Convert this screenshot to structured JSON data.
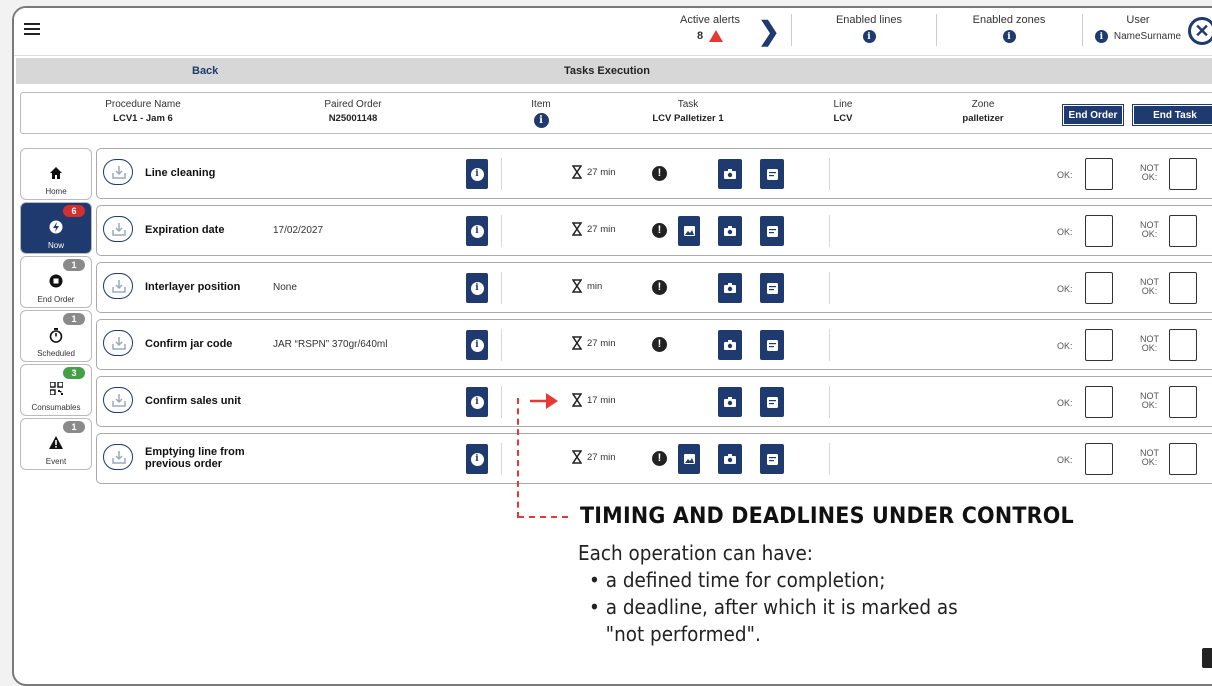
{
  "topbar": {
    "active_alerts_label": "Active alerts",
    "active_alerts_count": "8",
    "enabled_lines_label": "Enabled lines",
    "enabled_zones_label": "Enabled zones",
    "user_label": "User",
    "user_name": "NameSurname",
    "info_glyph": "i",
    "close_glyph": "✕"
  },
  "subbar": {
    "back_label": "Back",
    "title": "Tasks Execution"
  },
  "info": {
    "procedure_label": "Procedure Name",
    "procedure_value": "LCV1 - Jam 6",
    "order_label": "Paired Order",
    "order_value": "N25001148",
    "item_label": "Item",
    "task_label": "Task",
    "task_value": "LCV Palletizer 1",
    "line_label": "Line",
    "line_value": "LCV",
    "zone_label": "Zone",
    "zone_value": "palletizer",
    "end_order_label": "End Order",
    "end_task_label": "End Task"
  },
  "sidebar": {
    "items": [
      {
        "label": "Home",
        "badge": "",
        "icon": "home-icon"
      },
      {
        "label": "Now",
        "badge": "6",
        "icon": "bolt-icon"
      },
      {
        "label": "End Order",
        "badge": "1",
        "icon": "stop-icon"
      },
      {
        "label": "Scheduled",
        "badge": "1",
        "icon": "stopwatch-icon"
      },
      {
        "label": "Consumables",
        "badge": "3",
        "icon": "qr-icon"
      },
      {
        "label": "Event",
        "badge": "1",
        "icon": "warning-icon"
      }
    ]
  },
  "tasks": {
    "ok_label": "OK:",
    "not_ok_label_1": "NOT",
    "not_ok_label_2": "OK:",
    "rows": [
      {
        "name": "Line cleaning",
        "value": "",
        "time": "27 min"
      },
      {
        "name": "Expiration date",
        "value": "17/02/2027",
        "time": "27 min"
      },
      {
        "name": "Interlayer position",
        "value": "None",
        "time": "min"
      },
      {
        "name": "Confirm jar code",
        "value": "JAR “RSPN” 370gr/640ml",
        "time": "27 min"
      },
      {
        "name": "Confirm sales unit",
        "value": "",
        "time": "17 min"
      },
      {
        "name_line1": "Emptying line from",
        "name_line2": "previous order",
        "value": "",
        "time": "27 min"
      }
    ]
  },
  "annotation": {
    "title": "TIMING AND DEADLINES UNDER CONTROL",
    "intro": "Each operation can have:",
    "bullet1": "• a defined time for completion;",
    "bullet2": "• a deadline, after which it is marked as",
    "bullet2_cont": "\"not performed\"."
  },
  "colors": {
    "primary": "#1e3a6e",
    "alert": "#e53935",
    "badge_red": "#d32f2f",
    "badge_green": "#43a047",
    "badge_grey": "#8a8a8a"
  }
}
